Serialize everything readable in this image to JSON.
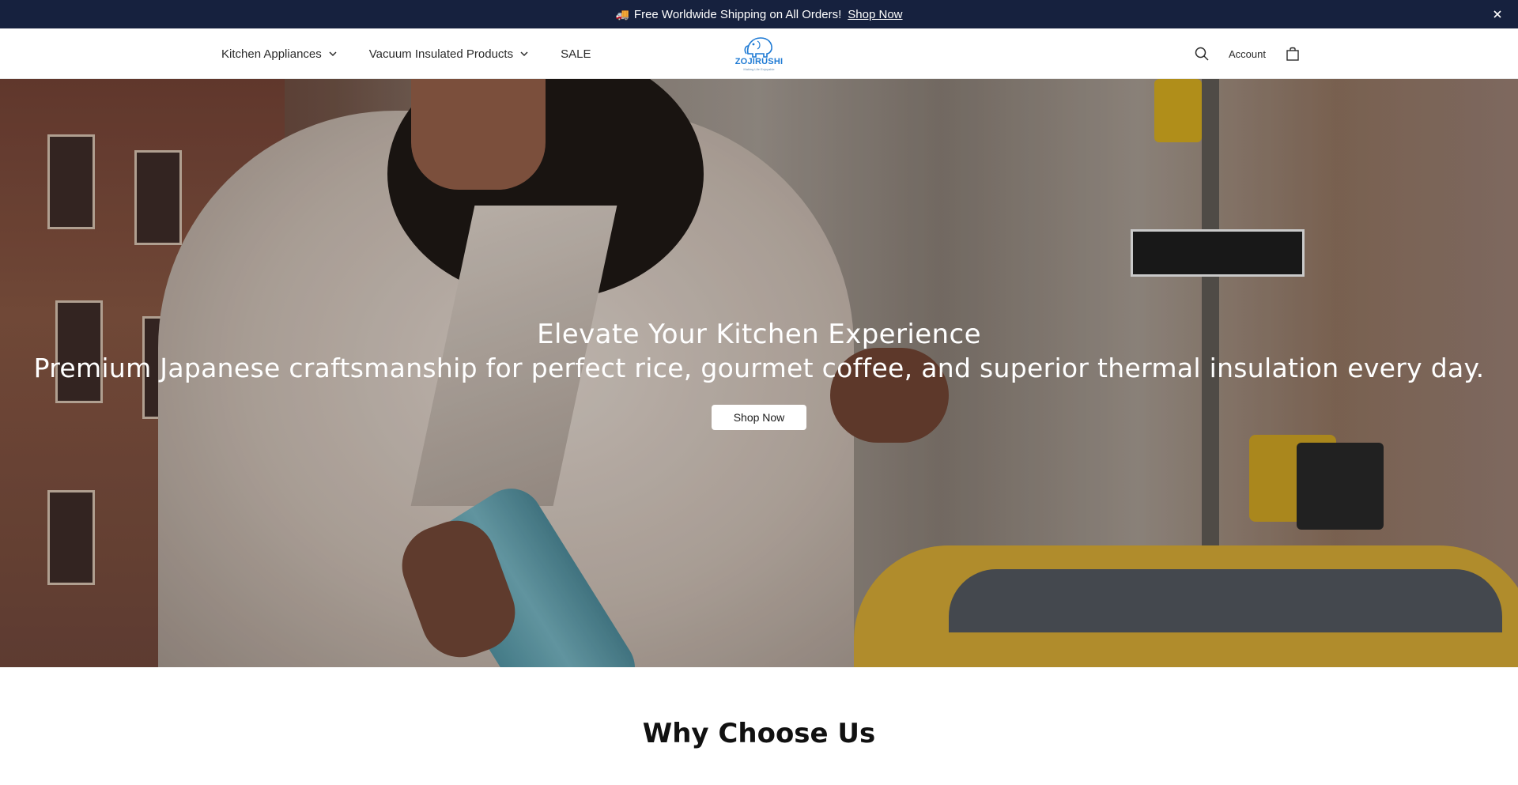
{
  "announcement": {
    "emoji": "🚚",
    "text": "Free Worldwide Shipping on All Orders!",
    "link": "Shop Now",
    "close_icon": "close-icon"
  },
  "header": {
    "nav": [
      {
        "label": "Kitchen Appliances",
        "has_dropdown": true
      },
      {
        "label": "Vacuum Insulated Products",
        "has_dropdown": true
      },
      {
        "label": "SALE",
        "has_dropdown": false
      }
    ],
    "logo": {
      "word": "ZOJIRUSHI",
      "tagline": "Making Life Enjoyable"
    },
    "account": "Account",
    "icons": [
      "search-icon",
      "bag-icon"
    ]
  },
  "hero": {
    "title": "Elevate Your Kitchen Experience",
    "subtitle": "Premium Japanese craftsmanship for perfect rice, gourmet coffee, and superior thermal insulation every day.",
    "button": "Shop Now"
  },
  "section": {
    "heading": "Why Choose Us"
  },
  "colors": {
    "announcement_bg": "#16213e",
    "logo_blue": "#1e7ad4"
  }
}
